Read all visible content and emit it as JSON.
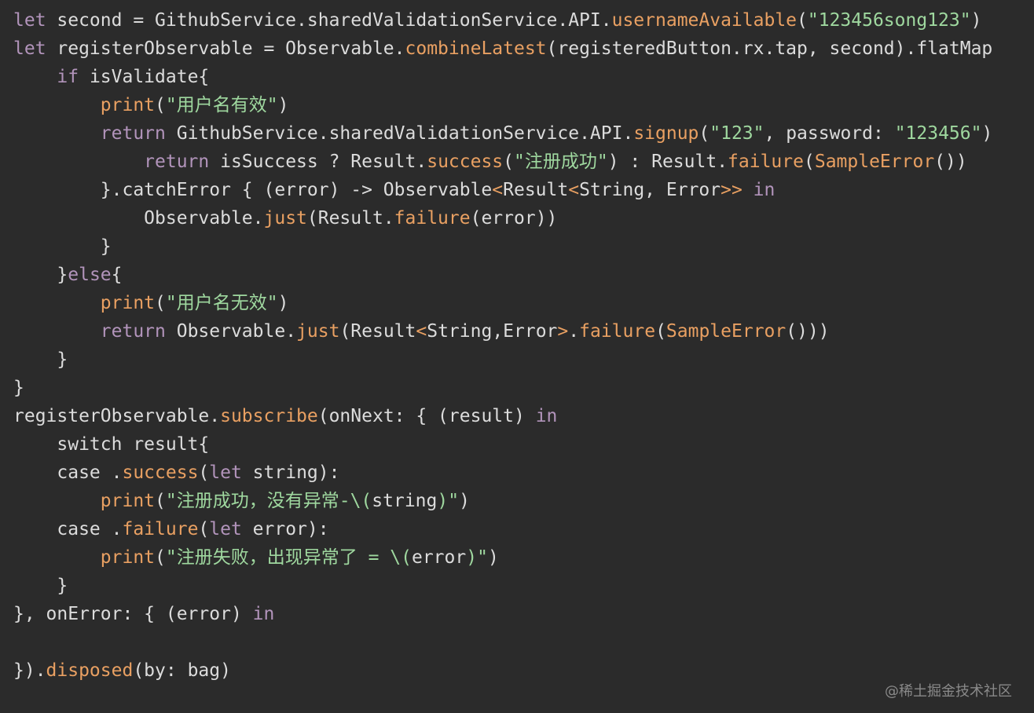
{
  "colors": {
    "background": "#2b2b2b",
    "keyword": "#b294bb",
    "identifier": "#dcdcdc",
    "function": "#e9a062",
    "string": "#9fd89f",
    "watermark": "#8a8a8a"
  },
  "code": {
    "lines": [
      [
        [
          "kw",
          "let"
        ],
        [
          "id",
          " second = GithubService.sharedValidationService.API."
        ],
        [
          "fn",
          "usernameAvailable"
        ],
        [
          "id",
          "("
        ],
        [
          "str",
          "\"123456song123\""
        ],
        [
          "id",
          ")"
        ]
      ],
      [
        [
          "kw",
          "let"
        ],
        [
          "id",
          " registerObservable = Observable."
        ],
        [
          "fn",
          "combineLatest"
        ],
        [
          "id",
          "(registeredButton.rx.tap, second).flatMap"
        ]
      ],
      [
        [
          "id",
          "    "
        ],
        [
          "kw",
          "if"
        ],
        [
          "id",
          " isValidate{"
        ]
      ],
      [
        [
          "id",
          "        "
        ],
        [
          "fn",
          "print"
        ],
        [
          "id",
          "("
        ],
        [
          "str",
          "\"用户名有效\""
        ],
        [
          "id",
          ")"
        ]
      ],
      [
        [
          "id",
          "        "
        ],
        [
          "kw",
          "return"
        ],
        [
          "id",
          " GithubService.sharedValidationService.API."
        ],
        [
          "fn",
          "signup"
        ],
        [
          "id",
          "("
        ],
        [
          "str",
          "\"123\""
        ],
        [
          "id",
          ", password: "
        ],
        [
          "str",
          "\"123456\""
        ],
        [
          "id",
          ")"
        ]
      ],
      [
        [
          "id",
          "            "
        ],
        [
          "kw",
          "return"
        ],
        [
          "id",
          " isSuccess ? Result."
        ],
        [
          "fn",
          "success"
        ],
        [
          "id",
          "("
        ],
        [
          "str",
          "\"注册成功\""
        ],
        [
          "id",
          ") : Result."
        ],
        [
          "fn",
          "failure"
        ],
        [
          "id",
          "("
        ],
        [
          "fn",
          "SampleError"
        ],
        [
          "id",
          "())"
        ]
      ],
      [
        [
          "id",
          "        }.catchError { (error) -> Observable"
        ],
        [
          "fn",
          "<"
        ],
        [
          "id",
          "Result"
        ],
        [
          "fn",
          "<"
        ],
        [
          "id",
          "String, Error"
        ],
        [
          "fn",
          ">>"
        ],
        [
          "id",
          " "
        ],
        [
          "kw",
          "in"
        ]
      ],
      [
        [
          "id",
          "            Observable."
        ],
        [
          "fn",
          "just"
        ],
        [
          "id",
          "(Result."
        ],
        [
          "fn",
          "failure"
        ],
        [
          "id",
          "(error))"
        ]
      ],
      [
        [
          "id",
          "        }"
        ]
      ],
      [
        [
          "id",
          "    }"
        ],
        [
          "kw",
          "else"
        ],
        [
          "id",
          "{"
        ]
      ],
      [
        [
          "id",
          "        "
        ],
        [
          "fn",
          "print"
        ],
        [
          "id",
          "("
        ],
        [
          "str",
          "\"用户名无效\""
        ],
        [
          "id",
          ")"
        ]
      ],
      [
        [
          "id",
          "        "
        ],
        [
          "kw",
          "return"
        ],
        [
          "id",
          " Observable."
        ],
        [
          "fn",
          "just"
        ],
        [
          "id",
          "(Result"
        ],
        [
          "fn",
          "<"
        ],
        [
          "id",
          "String,Error"
        ],
        [
          "fn",
          ">"
        ],
        [
          "id",
          "."
        ],
        [
          "fn",
          "failure"
        ],
        [
          "id",
          "("
        ],
        [
          "fn",
          "SampleError"
        ],
        [
          "id",
          "()))"
        ]
      ],
      [
        [
          "id",
          "    }"
        ]
      ],
      [
        [
          "id",
          "}"
        ]
      ],
      [
        [
          "id",
          "registerObservable."
        ],
        [
          "fn",
          "subscribe"
        ],
        [
          "id",
          "(onNext: { (result) "
        ],
        [
          "kw",
          "in"
        ]
      ],
      [
        [
          "id",
          "    switch result{"
        ]
      ],
      [
        [
          "id",
          "    case ."
        ],
        [
          "fn",
          "success"
        ],
        [
          "id",
          "("
        ],
        [
          "kw",
          "let"
        ],
        [
          "id",
          " string):"
        ]
      ],
      [
        [
          "id",
          "        "
        ],
        [
          "fn",
          "print"
        ],
        [
          "id",
          "("
        ],
        [
          "str",
          "\"注册成功，没有异常-\\("
        ],
        [
          "id",
          "string"
        ],
        [
          "str",
          ")\""
        ],
        [
          "id",
          ")"
        ]
      ],
      [
        [
          "id",
          "    case ."
        ],
        [
          "fn",
          "failure"
        ],
        [
          "id",
          "("
        ],
        [
          "kw",
          "let"
        ],
        [
          "id",
          " error):"
        ]
      ],
      [
        [
          "id",
          "        "
        ],
        [
          "fn",
          "print"
        ],
        [
          "id",
          "("
        ],
        [
          "str",
          "\"注册失败，出现异常了 = \\("
        ],
        [
          "id",
          "error"
        ],
        [
          "str",
          ")\""
        ],
        [
          "id",
          ")"
        ]
      ],
      [
        [
          "id",
          "    }"
        ]
      ],
      [
        [
          "id",
          "}, onError: { (error) "
        ],
        [
          "kw",
          "in"
        ]
      ],
      [
        [
          "id",
          ""
        ]
      ],
      [
        [
          "id",
          "})."
        ],
        [
          "fn",
          "disposed"
        ],
        [
          "id",
          "(by: bag)"
        ]
      ]
    ]
  },
  "watermark": "@稀土掘金技术社区"
}
